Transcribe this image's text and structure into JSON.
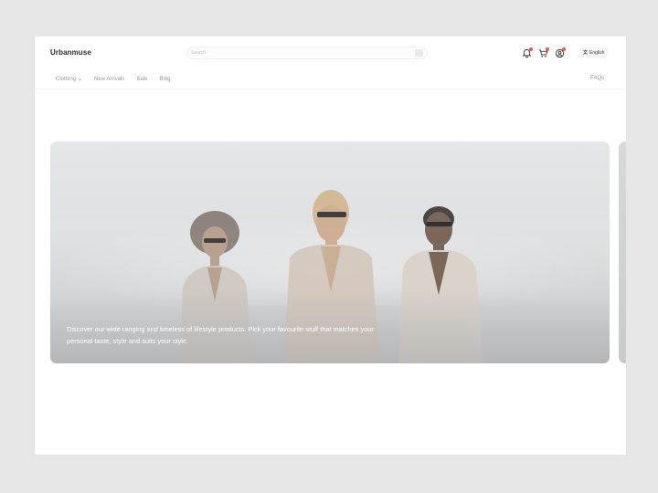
{
  "header": {
    "logo": "Urbanmuse",
    "search_placeholder": "Search",
    "icons": [
      "notification-icon",
      "cart-icon",
      "user-icon"
    ],
    "language": "English"
  },
  "nav": {
    "items": [
      {
        "label": "Clothing",
        "has_dropdown": true
      },
      {
        "label": "New Arrivals"
      },
      {
        "label": "Sale"
      },
      {
        "label": "Blog"
      }
    ],
    "faqs": "FAQs"
  },
  "hero": {
    "caption": "Discover our wide ranging and timeless of lifestyle products. Pick your favourite stuff that matches your personal taste, style and suits your style."
  },
  "colors": {
    "badge_dot": "#ff4d4f",
    "background": "#e6e6e6",
    "card": "#ffffff"
  }
}
